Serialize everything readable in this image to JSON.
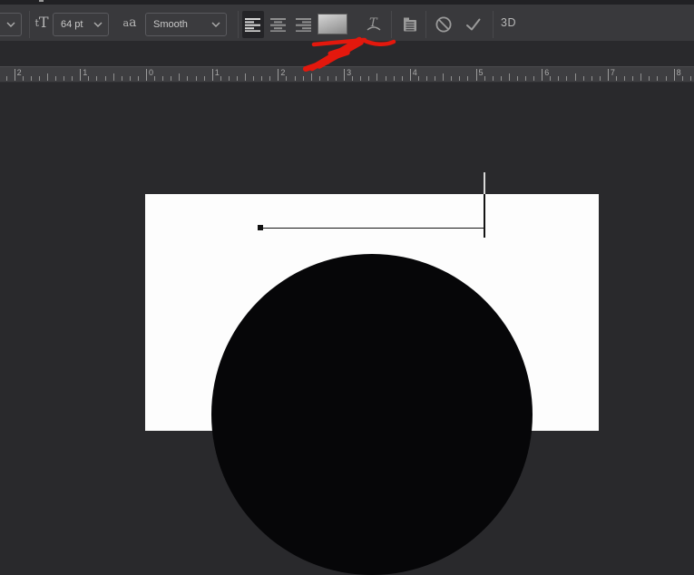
{
  "options_bar": {
    "font_size_icon": {
      "small": "t",
      "large": "T"
    },
    "font_size_value": "64 pt",
    "anti_alias_icon": {
      "first": "a",
      "second": "a"
    },
    "anti_alias_value": "Smooth",
    "alignment": {
      "options": [
        "left",
        "center",
        "right"
      ],
      "selected": "left"
    },
    "threed_label": "3D"
  },
  "ruler": {
    "unit_labels": [
      "2",
      "1",
      "0",
      "1",
      "2",
      "3",
      "4",
      "5",
      "6",
      "7",
      "8"
    ]
  },
  "colors": {
    "annotation_red": "#e3180d",
    "swatch_top": "#d6d6d6",
    "swatch_bottom": "#8a8a8a",
    "artboard_white": "#fdfdfd",
    "shape_black": "#060608"
  }
}
